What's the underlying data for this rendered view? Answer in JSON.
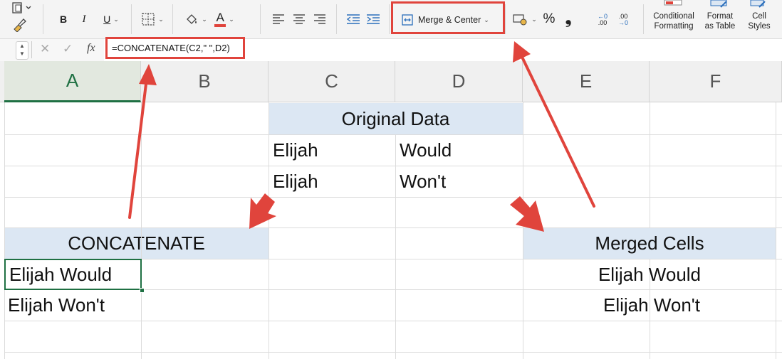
{
  "ribbon": {
    "bold": "B",
    "italic": "I",
    "underline": "U",
    "merge_label": "Merge & Center",
    "percent": "%",
    "comma": "❟",
    "inc_decimal": ".00",
    "dec_decimal": ".00",
    "cond_fmt_line1": "Conditional",
    "cond_fmt_line2": "Formatting",
    "fmt_table_line1": "Format",
    "fmt_table_line2": "as Table",
    "cell_styles_line1": "Cell",
    "cell_styles_line2": "Styles",
    "font_color_letter": "A"
  },
  "formula_bar": {
    "fx": "fx",
    "formula": "=CONCATENATE(C2,\" \",D2)"
  },
  "columns": [
    "A",
    "B",
    "C",
    "D",
    "E",
    "F"
  ],
  "cells": {
    "original_header": "Original Data",
    "c2": "Elijah",
    "d2": "Would",
    "c3": "Elijah",
    "d3": "Won't",
    "concat_header": "CONCATENATE",
    "a6": "Elijah  Would",
    "a7": "Elijah  Won't",
    "merged_header": "Merged Cells",
    "e6": "Elijah Would",
    "e7": "Elijah Won't"
  },
  "colors": {
    "accent_green": "#1f7043",
    "annotation_red": "#e0443c",
    "header_fill": "#dce7f3"
  }
}
